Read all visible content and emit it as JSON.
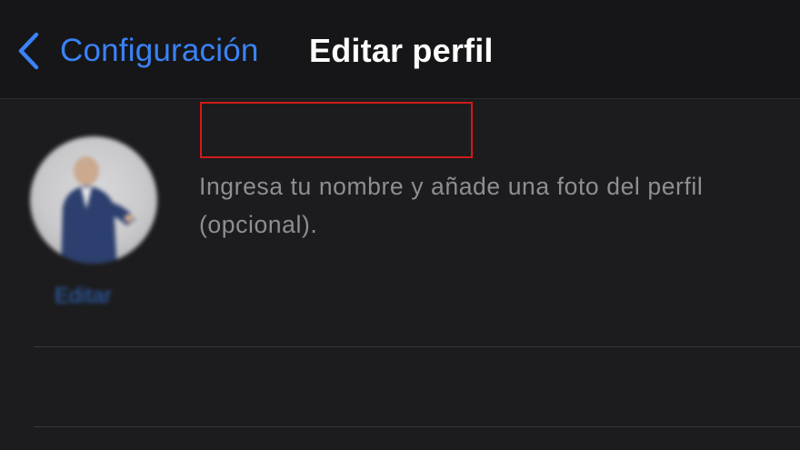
{
  "navbar": {
    "back_label": "Configuración",
    "title": "Editar perfil"
  },
  "profile": {
    "edit_photo_label": "Editar",
    "name_value": "",
    "hint": "Ingresa tu nombre y añade una foto del perfil (opcional)."
  },
  "icons": {
    "back": "chevron-left-icon"
  },
  "colors": {
    "background": "#1c1c1e",
    "navbar": "#161618",
    "accent": "#3a82f7",
    "highlight_box": "#d11a1a",
    "hint_text": "#8e8e93"
  }
}
